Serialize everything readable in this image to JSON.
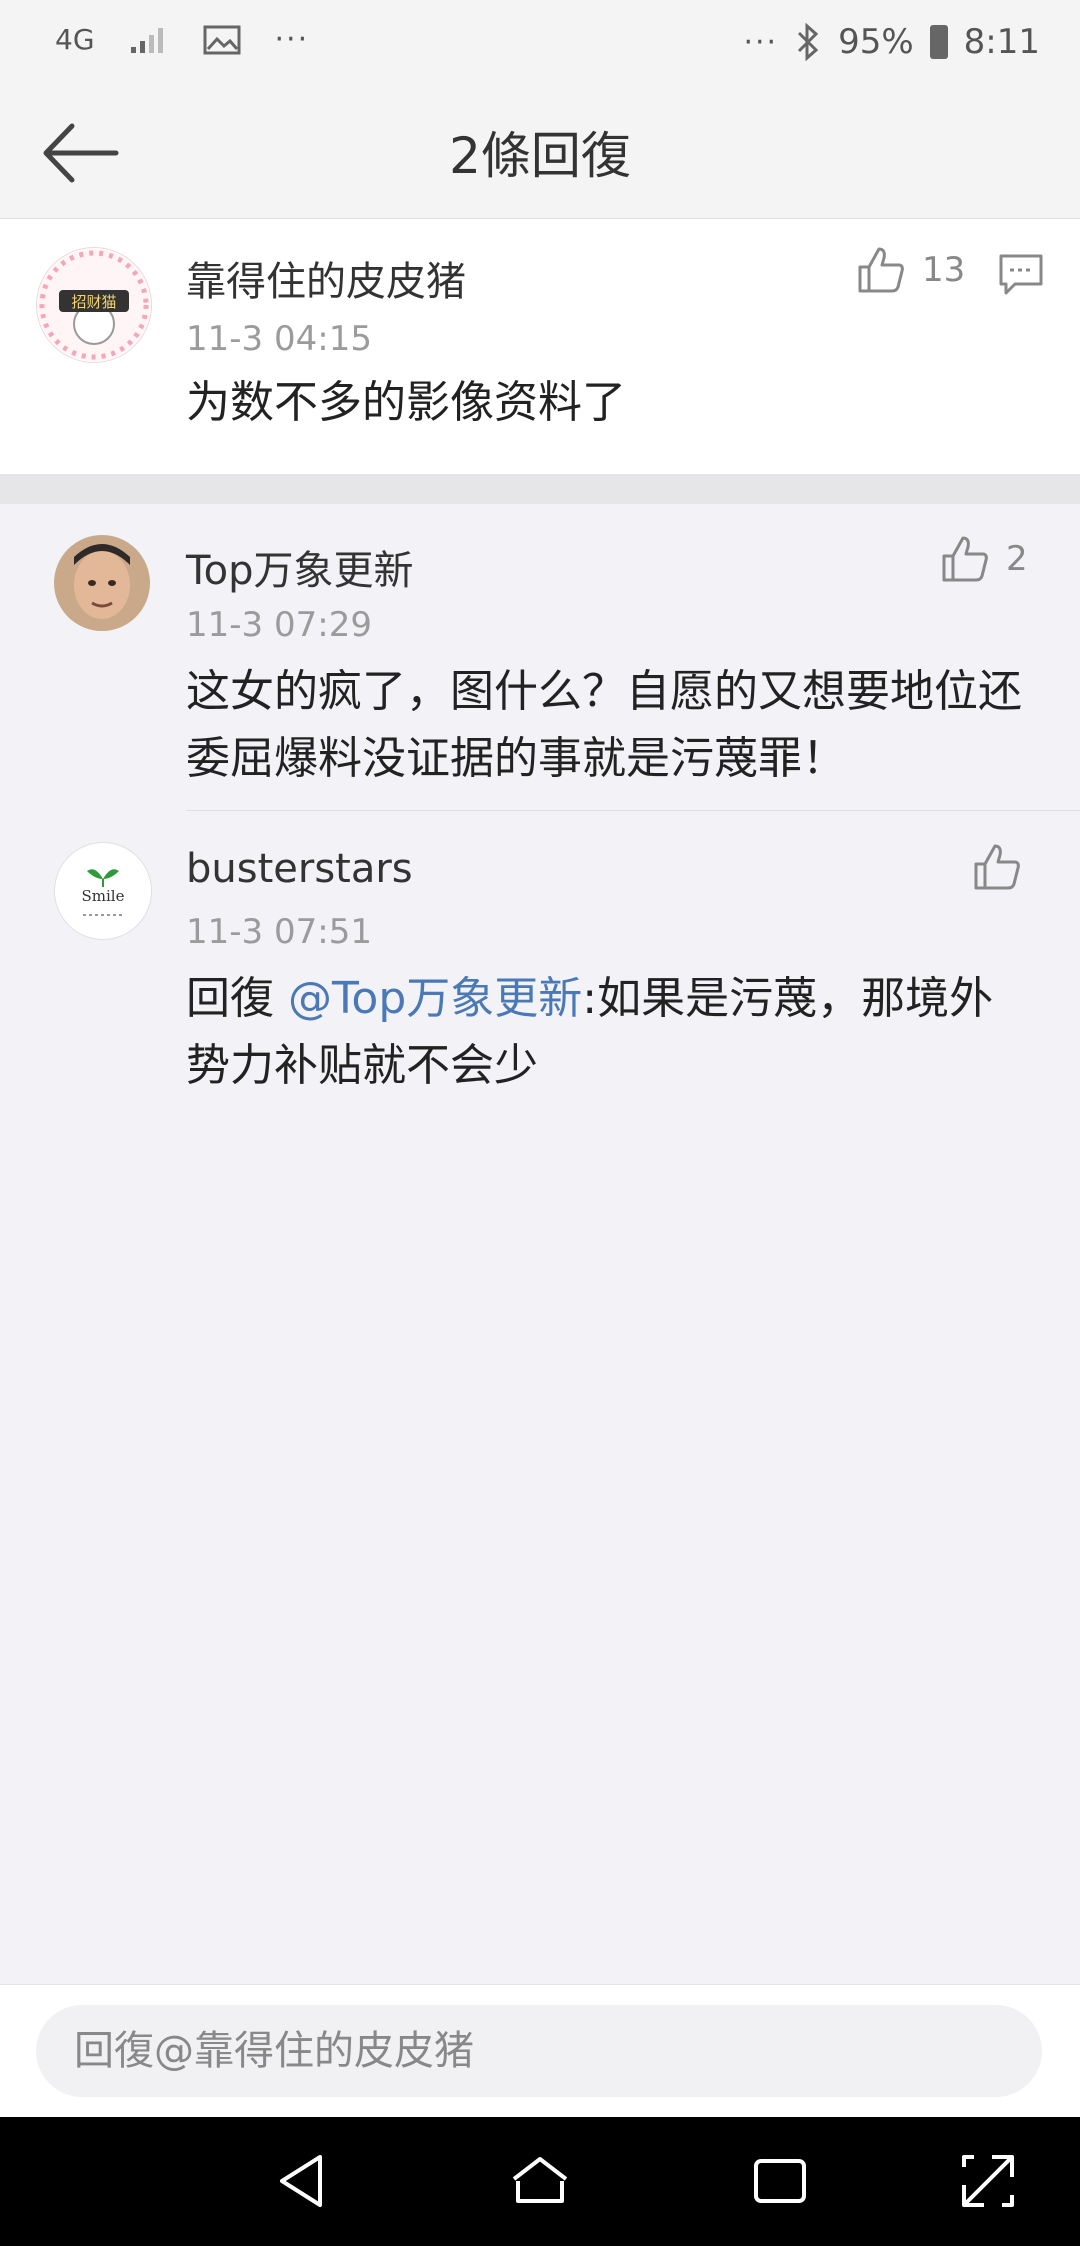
{
  "status_bar": {
    "network": "4G",
    "dots_left": "···",
    "dots_right": "···",
    "battery": "95%",
    "time": "8:11"
  },
  "header": {
    "title": "2條回復"
  },
  "main_comment": {
    "username": "靠得住的皮皮猪",
    "time": "11-3 04:15",
    "text": "为数不多的影像资料了",
    "likes": "13",
    "avatar_text": "招财猫"
  },
  "replies": [
    {
      "username": "Top万象更新",
      "time": "11-3 07:29",
      "text": "这女的疯了，图什么？自愿的又想要地位还委屈爆料没证据的事就是污蔑罪！",
      "likes": "2"
    },
    {
      "username": "busterstars",
      "time": "11-3 07:51",
      "reply_prefix": "回復 ",
      "mention": "@Top万象更新",
      "text": ":如果是污蔑，那境外势力补贴就不会少",
      "likes": "",
      "avatar_text": "Smile"
    }
  ],
  "reply_bar": {
    "placeholder": "回復@靠得住的皮皮猪"
  }
}
